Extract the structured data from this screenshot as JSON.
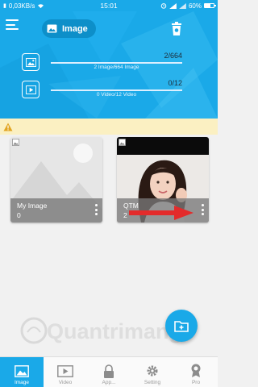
{
  "status_bar": {
    "network_speed": "0,03KB/s",
    "time": "15:01",
    "battery_percent": "60%",
    "battery_level": 0.6
  },
  "header": {
    "title": "Image",
    "image_stats": {
      "count": "2/664",
      "caption": "2 Image/664 Image"
    },
    "video_stats": {
      "count": "0/12",
      "caption": "0 Video/12 Video"
    }
  },
  "albums": [
    {
      "name": "My Image",
      "count": "0"
    },
    {
      "name": "QTM",
      "count": "2"
    }
  ],
  "bottom_nav": [
    {
      "label": "Image",
      "icon": "image-icon"
    },
    {
      "label": "Video",
      "icon": "video-icon"
    },
    {
      "label": "App...",
      "icon": "lock-icon"
    },
    {
      "label": "Setting",
      "icon": "gear-icon"
    },
    {
      "label": "Pro",
      "icon": "award-icon"
    }
  ],
  "watermark": "Quantrimang",
  "colors": {
    "primary": "#1aa9e8",
    "warning_bg": "#fbf0c2",
    "warning_icon": "#e2a521",
    "annotation_arrow": "#e32b2b"
  }
}
